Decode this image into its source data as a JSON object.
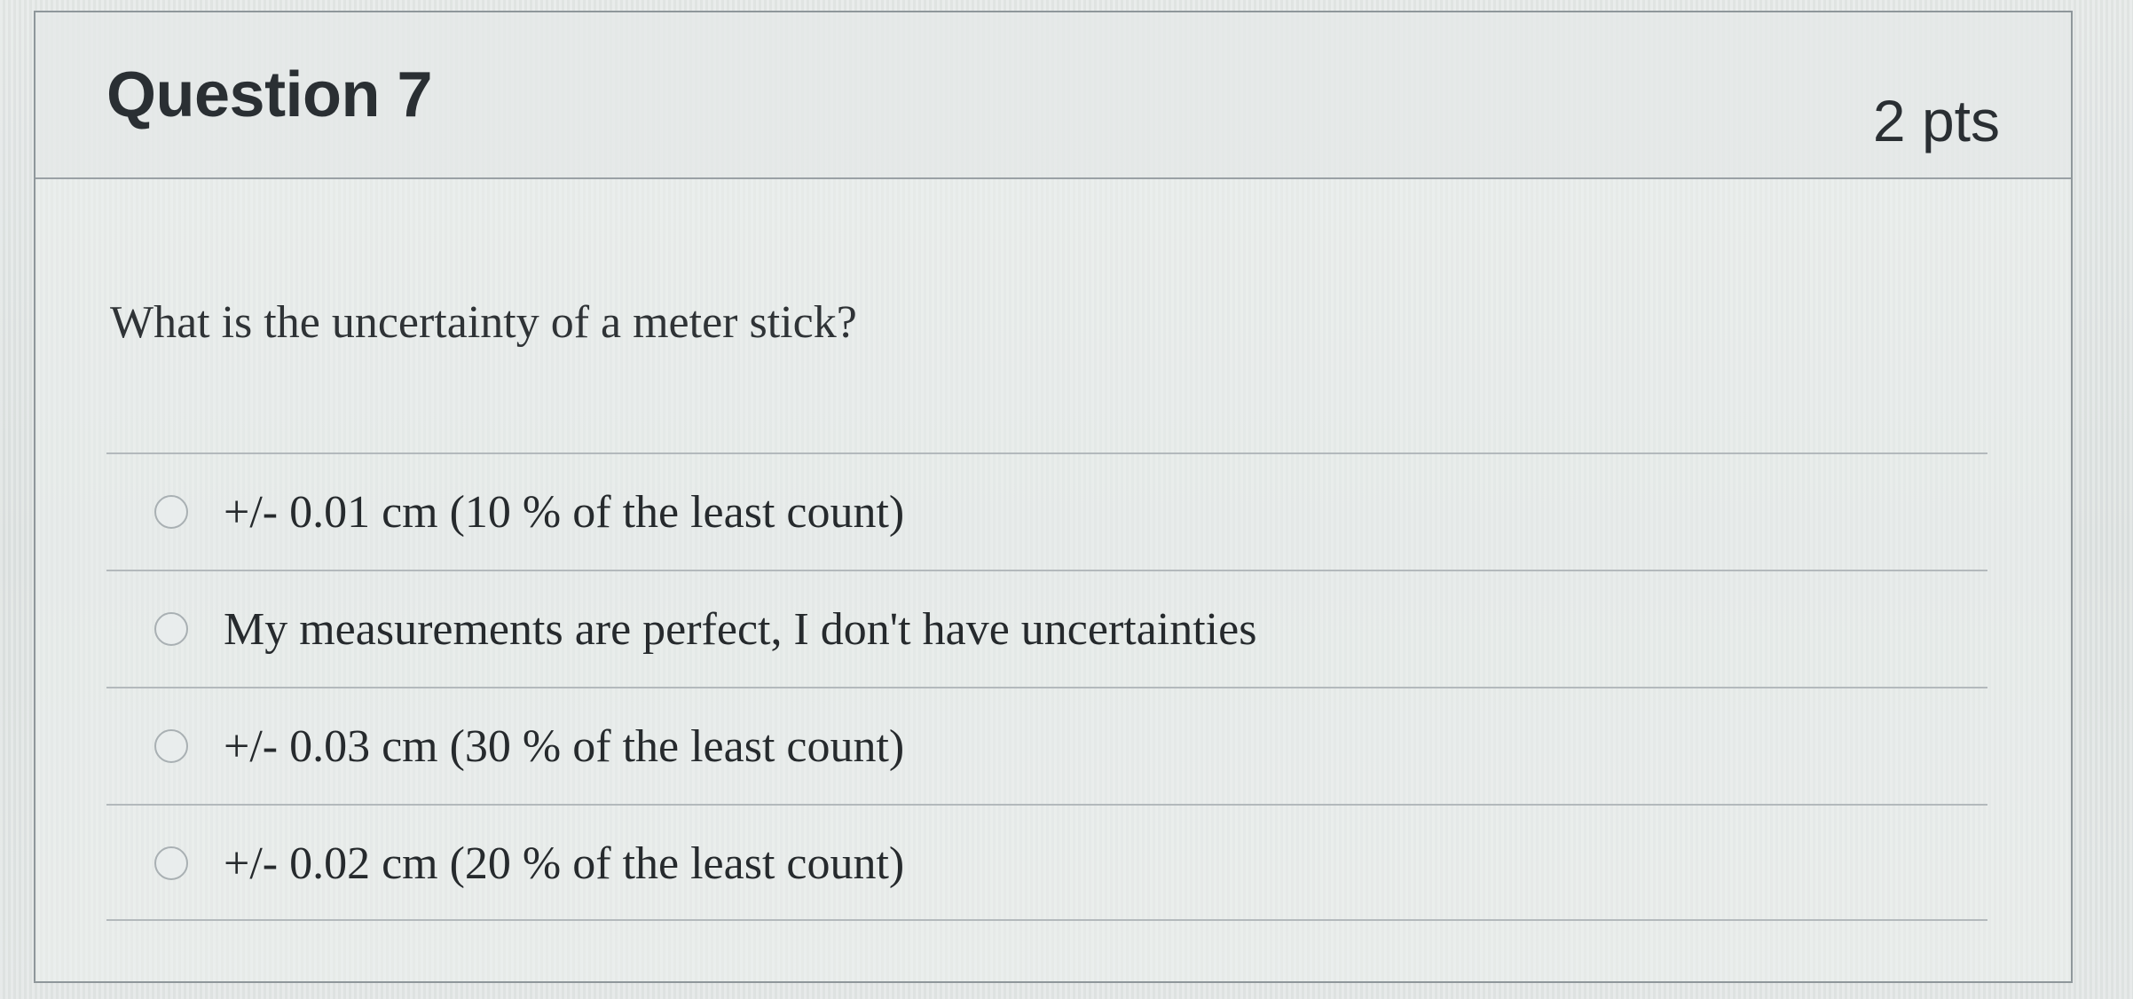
{
  "question": {
    "title": "Question 7",
    "points": "2 pts",
    "prompt": "What is the uncertainty of a meter stick?"
  },
  "answers": [
    {
      "label": "+/- 0.01 cm (10 % of the least count)"
    },
    {
      "label": "My measurements are perfect, I don't have uncertainties"
    },
    {
      "label": "+/- 0.03 cm (30 % of the least count)"
    },
    {
      "label": "+/- 0.02 cm (20 % of the least count)"
    }
  ]
}
